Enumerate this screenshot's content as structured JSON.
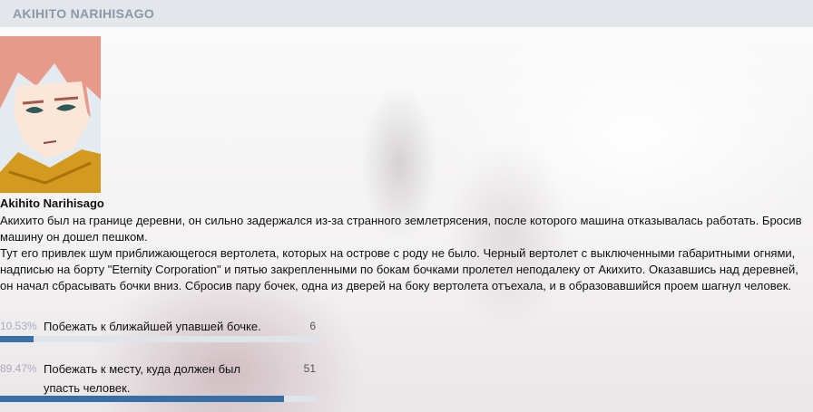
{
  "header": {
    "title": "AKIHITO NARIHISAGO"
  },
  "post": {
    "author": "Akihito Narihisago",
    "paragraphs": [
      "Акихито был на границе деревни, он сильно задержался из-за странного землетрясения, после которого машина отказывалась работать. Бросив машину он дошел пешком.",
      "Тут его привлек шум приближающегося вертолета, которых на острове с роду не было. Черный вертолет с выключенными габаритными огнями, надписью на борту \"Eternity Corporation\" и пятью закрепленными по бокам бочками пролетел неподалеку от Акихито. Оказавшись над деревней, он начал сбрасывать бочки вниз. Сбросив пару бочек, одна из дверей на боку вертолета отъехала, и в образовавшийся проем шагнул человек."
    ]
  },
  "poll": {
    "options": [
      {
        "percent": "10.53%",
        "label": "Побежать к ближайшей упавшей бочке.",
        "votes": "6",
        "fraction": 0.1053
      },
      {
        "percent": "89.47%",
        "label": "Побежать к месту, куда должен был упасть человек.",
        "votes": "51",
        "fraction": 0.8947
      }
    ]
  }
}
